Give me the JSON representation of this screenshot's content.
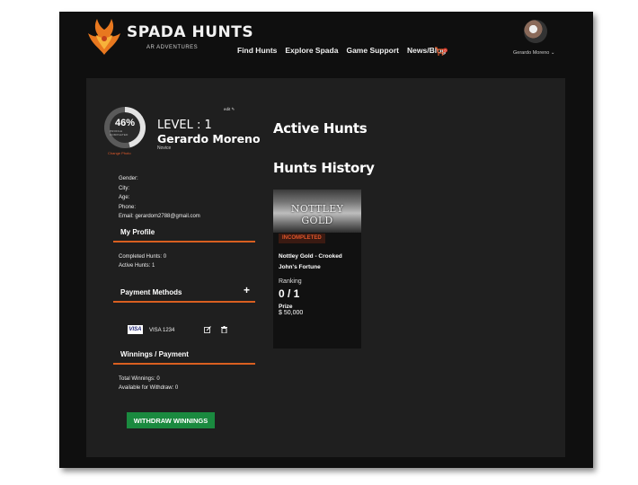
{
  "header": {
    "brand": "SPADA HUNTS",
    "tagline": "AR ADVENTURES",
    "nav": [
      "Find Hunts",
      "Explore Spada",
      "Game Support",
      "News/Blog"
    ],
    "cart_count": "0",
    "username": "Gerardo Moreno"
  },
  "profile": {
    "progress_pct": "46%",
    "progress_caption": "PROFILE COMPLETED",
    "change_photo": "Change Photo",
    "edit_label": "edit",
    "level": "LEVEL : 1",
    "name": "Gerardo Moreno",
    "rank": "Novice",
    "info": {
      "gender": "Gender:",
      "city": "City:",
      "age": "Age:",
      "phone": "Phone:",
      "email": "Email: gerardom2788@gmail.com"
    }
  },
  "my_profile": {
    "title": "My Profile",
    "completed": "Completed Hunts: 0",
    "active": "Active Hunts: 1"
  },
  "payment": {
    "title": "Payment Methods",
    "add_label": "+",
    "card_brand": "VISA",
    "card_text": "VISA 1234"
  },
  "winnings": {
    "title": "Winnings / Payment",
    "total": "Total Winnings: 0",
    "available": "Available for Withdraw: 0",
    "withdraw_label": "WITHDRAW WINNINGS"
  },
  "main": {
    "active_title": "Active Hunts",
    "history_title": "Hunts History",
    "hunt": {
      "image_text": "NOTTLEY GOLD",
      "status": "INCOMPLETED",
      "title": "Nottley Gold - Crooked John's Fortune",
      "ranking_label": "Ranking",
      "ranking_value": "0 / 1",
      "prize_label": "Prize",
      "prize_value": "$ 50,000"
    }
  },
  "colors": {
    "accent": "#d95f20",
    "success": "#1a8a3f",
    "background": "#0f0f0f",
    "panel": "#1f1f1f"
  }
}
